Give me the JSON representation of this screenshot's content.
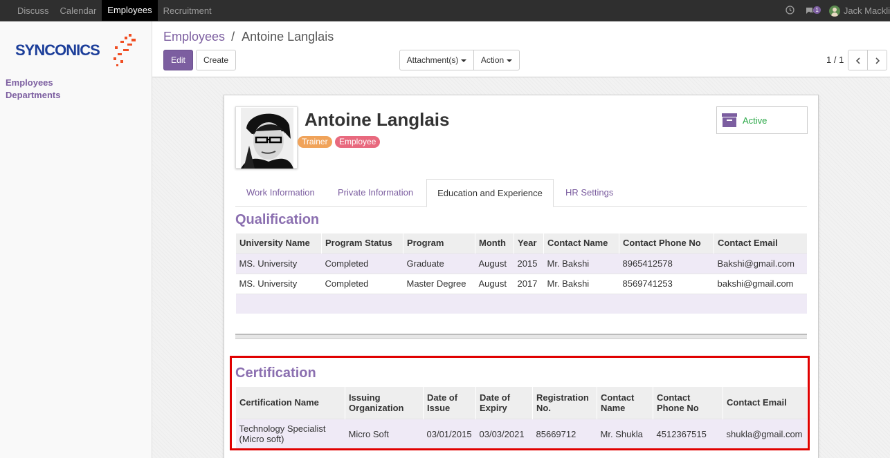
{
  "topbar": {
    "menu": [
      "Discuss",
      "Calendar",
      "Employees",
      "Recruitment"
    ],
    "active_menu": "Employees",
    "chat_count": "1",
    "user": "Jack Mackli"
  },
  "brand": {
    "logo_text": "SYNCONICS"
  },
  "sidebar": {
    "items": [
      {
        "label": "Employees"
      },
      {
        "label": "Departments"
      }
    ]
  },
  "breadcrumb": {
    "parent": "Employees",
    "separator": "/",
    "current": "Antoine Langlais"
  },
  "buttons": {
    "edit": "Edit",
    "create": "Create",
    "attachments": "Attachment(s)",
    "action": "Action"
  },
  "pager": {
    "value": "1 / 1"
  },
  "employee": {
    "name": "Antoine Langlais",
    "tags": [
      "Trainer",
      "Employee"
    ],
    "status": "Active"
  },
  "tabs": [
    "Work Information",
    "Private Information",
    "Education and Experience",
    "HR Settings"
  ],
  "active_tab": "Education and Experience",
  "qualification": {
    "title": "Qualification",
    "columns": [
      "University Name",
      "Program Status",
      "Program",
      "Month",
      "Year",
      "Contact Name",
      "Contact Phone No",
      "Contact Email"
    ],
    "rows": [
      [
        "MS. University",
        "Completed",
        "Graduate",
        "August",
        "2015",
        "Mr. Bakshi",
        "8965412578",
        "Bakshi@gmail.com"
      ],
      [
        "MS. University",
        "Completed",
        "Master Degree",
        "August",
        "2017",
        "Mr. Bakshi",
        "8569741253",
        "bakshi@gmail.com"
      ]
    ]
  },
  "certification": {
    "title": "Certification",
    "columns": [
      "Certification Name",
      "Issuing Organization",
      "Date of Issue",
      "Date of Expiry",
      "Registration No.",
      "Contact Name",
      "Contact Phone No",
      "Contact Email"
    ],
    "rows": [
      [
        "Technology Specialist (Micro soft)",
        "Micro Soft",
        "03/01/2015",
        "03/03/2021",
        "85669712",
        "Mr. Shukla",
        "4512367515",
        "shukla@gmail.com"
      ]
    ]
  },
  "colors": {
    "accent": "#7c5ea0",
    "trainer_tag": "#f0a35a",
    "employee_tag": "#e8697e",
    "highlight": "#e00000"
  }
}
